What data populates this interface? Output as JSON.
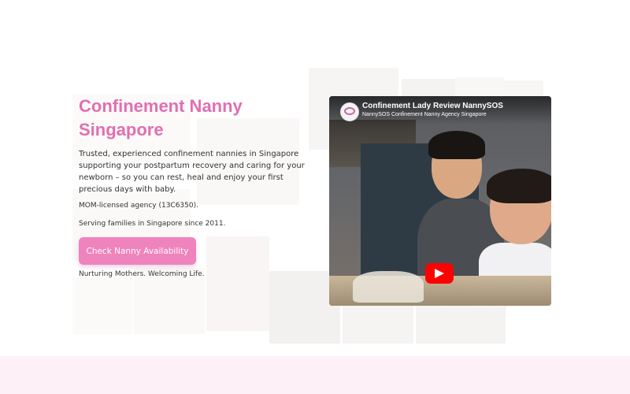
{
  "hero": {
    "title": "Confinement Nanny Singapore",
    "lead": "Trusted, experienced confinement nannies in Singapore supporting your postpartum recovery and caring for your newborn – so you can rest, heal and enjoy your first precious days with baby.",
    "license": "MOM-licensed agency (13C6350).",
    "since": "Serving families in Singapore since 2011.",
    "cta_label": "Check Nanny Availability",
    "tagline": "Nurturing Mothers. Welcoming Life."
  },
  "video": {
    "title": "Confinement Lady Review NannySOS",
    "channel": "NannySOS Confinement Nanny Agency Singapore",
    "avatar_text": "Nanny SOS",
    "play_icon": "play-icon"
  },
  "colors": {
    "accent": "#e06fb2",
    "button": "#ef83bd",
    "band": "#fdf0f6",
    "play": "#ff0000"
  }
}
